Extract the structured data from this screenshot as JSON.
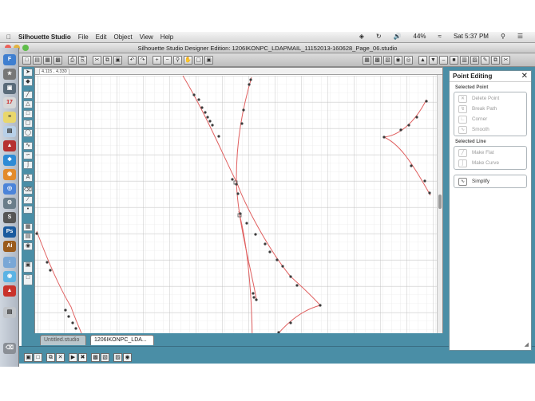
{
  "menubar": {
    "app_name": "Silhouette Studio",
    "items": [
      "File",
      "Edit",
      "Object",
      "View",
      "Help"
    ],
    "battery": "44%",
    "clock": "Sat 5:37 PM"
  },
  "window": {
    "title": "Silhouette Studio Designer Edition: 1206IKONPC_LDAPMAIL_11152013-160628_Page_06.studio"
  },
  "canvas": {
    "coordinate_readout": "4.115 , 4.330"
  },
  "tabs": [
    {
      "label": "Untitled.studio",
      "active": false
    },
    {
      "label": "1206IKONPC_LDA...",
      "active": true
    }
  ],
  "point_editing": {
    "title": "Point Editing",
    "selected_point_label": "Selected Point",
    "point_actions": [
      {
        "label": "Delete Point",
        "icon": "delete-point-icon"
      },
      {
        "label": "Break Path",
        "icon": "break-path-icon"
      },
      {
        "label": "Corner",
        "icon": "corner-icon"
      },
      {
        "label": "Smooth",
        "icon": "smooth-icon"
      }
    ],
    "selected_line_label": "Selected Line",
    "line_actions": [
      {
        "label": "Make Flat",
        "icon": "make-flat-icon"
      },
      {
        "label": "Make Curve",
        "icon": "make-curve-icon"
      }
    ],
    "simplify_label": "Simplify"
  },
  "colors": {
    "app_teal": "#4a8ea6",
    "path_red": "#e06060",
    "node_dark": "#3b3b3b",
    "grid_line": "#c8c8c8"
  }
}
